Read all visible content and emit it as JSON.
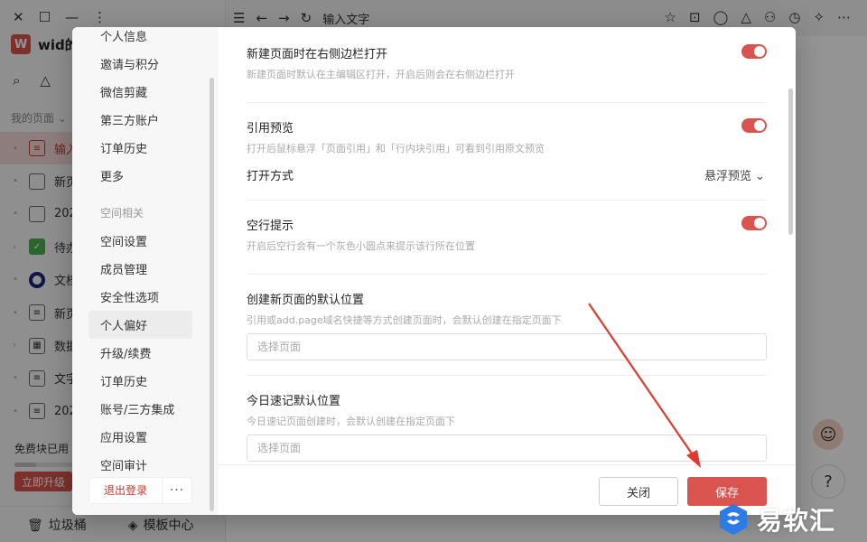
{
  "app": {
    "workspace_logo": "W",
    "workspace_name": "wid的",
    "tab_title": "输入文字",
    "my_pages_label": "我的页面 ⌄",
    "pages": [
      {
        "label": "输入",
        "icon": "page-icon",
        "active": true
      },
      {
        "label": "新页",
        "icon": "blank-page-icon"
      },
      {
        "label": "202",
        "icon": "blank-page-icon"
      },
      {
        "label": "待办",
        "icon": "checkbox-icon"
      },
      {
        "label": "文档",
        "icon": "target-icon"
      },
      {
        "label": "新页",
        "icon": "page-icon"
      },
      {
        "label": "数据",
        "icon": "table-icon"
      },
      {
        "label": "文字",
        "icon": "page-icon"
      },
      {
        "label": "202",
        "icon": "page-icon"
      }
    ],
    "free_blocks_label": "免费块已用",
    "free_blocks_progress": 0.3,
    "upgrade_label": "立即升级",
    "trash_label": "垃圾桶",
    "templates_label": "模板中心"
  },
  "settings_nav": {
    "items_top": [
      "个人信息",
      "邀请与积分",
      "微信剪藏",
      "第三方账户",
      "订单历史",
      "更多"
    ],
    "group_label": "空间相关",
    "items_space": [
      "空间设置",
      "成员管理",
      "安全性选项",
      "个人偏好",
      "升级/续费",
      "订单历史",
      "账号/三方集成",
      "应用设置",
      "空间审计"
    ],
    "active_item": "个人偏好",
    "logout_label": "退出登录",
    "more_label": "···"
  },
  "settings": {
    "open_in_sidebar": {
      "title": "新建页面时在右侧边栏打开",
      "desc": "新建页面时默认在主编辑区打开，开启后则会在右侧边栏打开",
      "enabled": true
    },
    "ref_preview": {
      "title": "引用预览",
      "desc": "打开后鼠标悬浮「页面引用」和「行内块引用」可看到引用原文预览",
      "enabled": true,
      "open_mode_label": "打开方式",
      "open_mode_value": "悬浮预览 ⌄"
    },
    "empty_line_hint": {
      "title": "空行提示",
      "desc": "开启后空行会有一个灰色小圆点来提示该行所在位置",
      "enabled": true
    },
    "new_page_location": {
      "title": "创建新页面的默认位置",
      "desc": "引用或add.page域名快捷等方式创建页面时，会默认创建在指定页面下",
      "placeholder": "选择页面"
    },
    "daily_note_location": {
      "title": "今日速记默认位置",
      "desc": "今日速记页面创建时，会默认创建在指定页面下",
      "placeholder": "选择页面"
    }
  },
  "footer": {
    "close_label": "关闭",
    "save_label": "保存"
  },
  "watermark": {
    "text": "易软汇"
  },
  "colors": {
    "accent": "#d9534f",
    "annotation_arrow": "#e03a2f"
  }
}
